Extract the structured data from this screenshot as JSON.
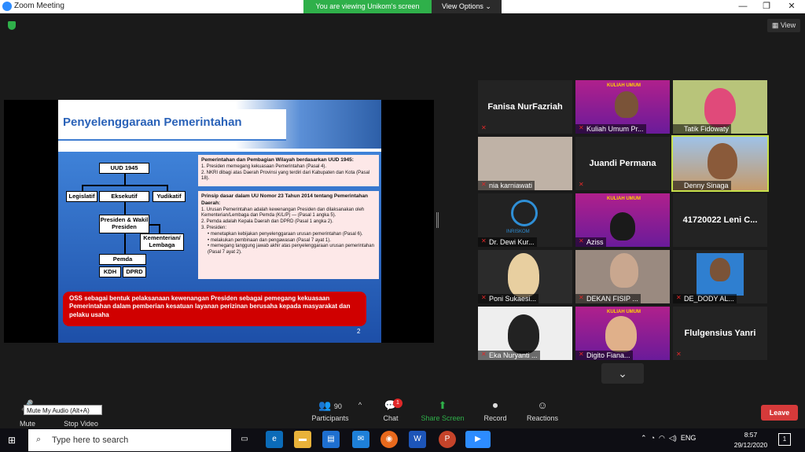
{
  "window": {
    "title": "Zoom Meeting",
    "viewing_banner": "You are viewing Unikom's screen",
    "view_options": "View Options ⌄",
    "minimize": "—",
    "maximize": "❐",
    "close": "✕",
    "view_button": "View"
  },
  "slide": {
    "title": "Penyelenggaraan Pemerintahan",
    "org": {
      "uud": "UUD 1945",
      "legislatif": "Legislatif",
      "eksekutif": "Eksekutif",
      "yudikatif": "Yudikatif",
      "presiden": "Presiden & Wakil Presiden",
      "kementerian": "Kementerian/ Lembaga",
      "pemda": "Pemda",
      "kdh": "KDH",
      "dprd": "DPRD"
    },
    "box1_title": "Pemerintahan dan Pembagian Wilayah berdasarkan UUD 1945:",
    "box1_items": [
      "1.  Presiden memegang kekuasaan Pemerintahan  (Pasal 4).",
      "2.  NKRI dibagi atas Daerah Provinsi yang terdiri dari Kabupaten dan Kota (Pasal 18)."
    ],
    "box2_title": "Prinsip dasar dalam UU Nomor 23 Tahun 2014 tentang Pemerintahan Daerah:",
    "box2_items": [
      "1.  Urusan Pemerintahan adalah kewenangan Presiden dan dilaksanakan oleh Kementerian/Lembaga dan Pemda (K/L/P) — (Pasal 1 angka 5).",
      "2.  Pemda adalah Kepala Daerah dan DPRD (Pasal 1 angka 2).",
      "3.  Presiden:",
      "•  menetapkan kebijakan penyelenggaraan urusan pemerintahan (Pasal 6).",
      "•  melakukan pembinaan dan pengawasan (Pasal 7 ayat 1).",
      "•  memegang tanggung jawab akhir atas penyelenggaraan urusan pemerintahan (Pasal 7 ayat 2)."
    ],
    "oss_text": "OSS sebagai bentuk pelaksanaan kewenangan Presiden sebagai pemegang kekuasaan Pemerintahan dalam pemberian kesatuan layanan perizinan berusaha kepada masyarakat dan pelaku usaha",
    "page_number": "2"
  },
  "gallery": [
    {
      "name": "Fanisa NurFazriah",
      "type": "name-only"
    },
    {
      "name": "Kuliah Umum Pr...",
      "type": "kuliah",
      "banner": "KULIAH UMUM"
    },
    {
      "name": "Tatik Fidowaty",
      "type": "video"
    },
    {
      "name": "nia karniawati",
      "type": "video"
    },
    {
      "name": "Juandi Permana",
      "type": "name-only"
    },
    {
      "name": "Denny Sinaga",
      "type": "video",
      "active": true
    },
    {
      "name": "Dr. Dewi Kur...",
      "type": "logo",
      "logo_text": "INRISKOM"
    },
    {
      "name": "Aziss",
      "type": "kuliah",
      "banner": "KULIAH UMUM"
    },
    {
      "name": "41720022 Leni C...",
      "type": "name-only"
    },
    {
      "name": "Poni Sukaesi...",
      "type": "video"
    },
    {
      "name": "DEKAN FISIP ...",
      "type": "video"
    },
    {
      "name": "DE_DODY AL...",
      "type": "video"
    },
    {
      "name": "Eka Nuryanti ...",
      "type": "video"
    },
    {
      "name": "Digito Fiana...",
      "type": "kuliah",
      "banner": "KULIAH UMUM"
    },
    {
      "name": "Flulgensius Yanri",
      "type": "name-only"
    }
  ],
  "controls": {
    "mute": "Mute",
    "mute_tooltip": "Mute My Audio (Alt+A)",
    "stop_video": "Stop Video",
    "participants": "Participants",
    "participants_count": "90",
    "chat": "Chat",
    "chat_badge": "1",
    "share_screen": "Share Screen",
    "record": "Record",
    "reactions": "Reactions",
    "leave": "Leave"
  },
  "taskbar": {
    "search_placeholder": "Type here to search",
    "time": "8:57",
    "date": "29/12/2020",
    "language": "ENG",
    "notifications": "1"
  }
}
